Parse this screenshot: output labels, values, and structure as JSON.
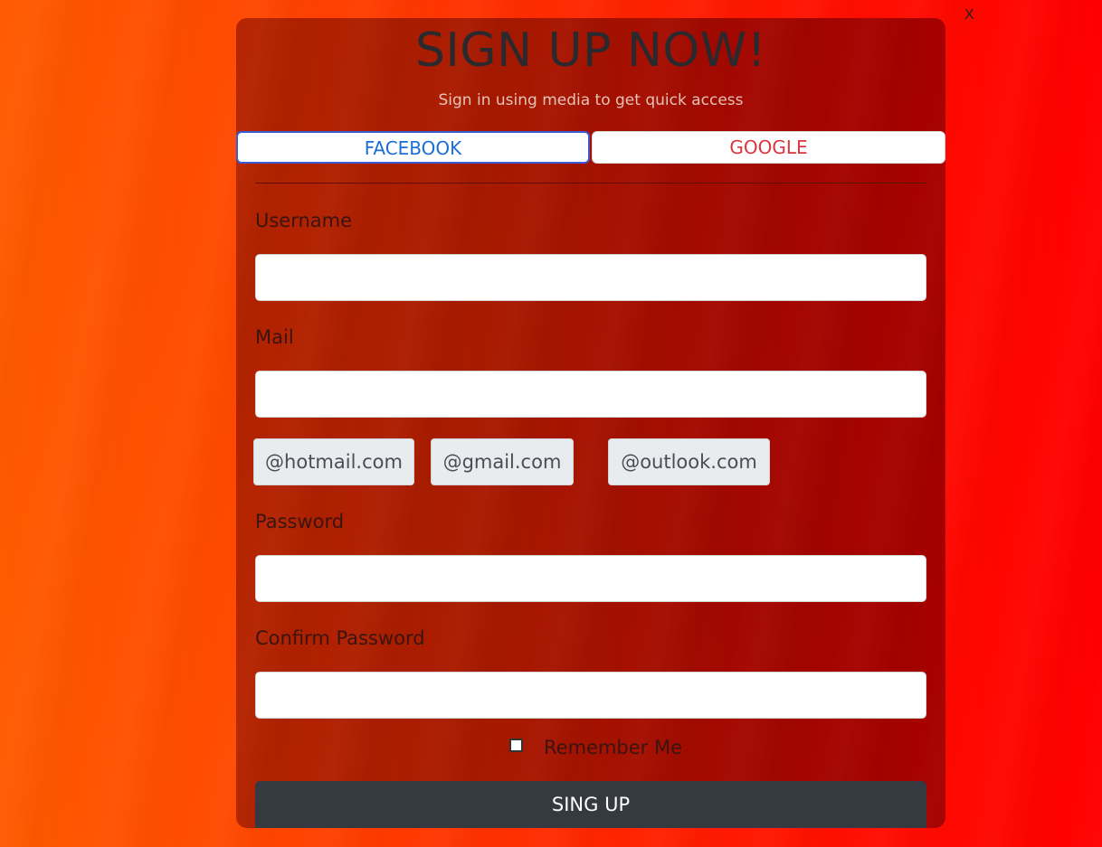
{
  "close": {
    "label": "X"
  },
  "modal": {
    "title": "SIGN UP NOW!",
    "subtitle": "Sign in using media to get quick access",
    "social": {
      "facebook_label": "FACEBOOK",
      "google_label": "GOOGLE"
    },
    "fields": {
      "username": {
        "label": "Username",
        "value": "",
        "placeholder": ""
      },
      "mail": {
        "label": "Mail",
        "value": "",
        "placeholder": ""
      },
      "password": {
        "label": "Password",
        "value": "",
        "placeholder": ""
      },
      "confirm_password": {
        "label": "Confirm Password",
        "value": "",
        "placeholder": ""
      }
    },
    "mail_domains": [
      "@hotmail.com",
      "@gmail.com",
      "@outlook.com"
    ],
    "remember_me": {
      "label": "Remember Me",
      "checked": false
    },
    "submit_label": "SING UP"
  },
  "colors": {
    "background": "#ff3000",
    "modal": "#a81a00",
    "facebook": "#1a6ed8",
    "google": "#d9363e",
    "submit_button": "#343a40",
    "title_text": "#2a2a2e"
  }
}
